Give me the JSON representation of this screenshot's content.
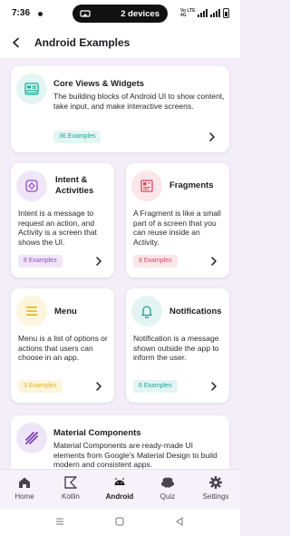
{
  "status_bar": {
    "time": "7:36",
    "cast_label": "2 devices",
    "signal_text_top": "Vo LTE",
    "signal_text_bottom": "4G"
  },
  "app_bar": {
    "title": "Android Examples"
  },
  "cards": [
    {
      "title": "Core Views & Widgets",
      "description": "The building blocks of Android UI to show content, take input, and make interactive screens.",
      "badge": "36 Examples",
      "icon": "layout-icon",
      "accent": "#17a99a",
      "tint": "#e3f6f3"
    },
    {
      "title": "Intent & Activities",
      "description": "Intent is a message to request an action, and Activity is a screen that shows the UI.",
      "badge": "8 Examples",
      "icon": "intent-icon",
      "accent": "#8e4fc4",
      "tint": "#f0e6f8"
    },
    {
      "title": "Fragments",
      "description": "A Fragment is like a small part of a screen that you can reuse inside an Activity.",
      "badge": "8 Examples",
      "icon": "fragments-icon",
      "accent": "#d9475f",
      "tint": "#fbe6e9"
    },
    {
      "title": "Menu",
      "description": "Menu is a list of options or actions that users can choose in an app.",
      "badge": "3 Examples",
      "icon": "menu-icon",
      "accent": "#e2b21c",
      "tint": "#fdf5dc"
    },
    {
      "title": "Notifications",
      "description": "Notification is a message shown outside the app to inform the user.",
      "badge": "6 Examples",
      "icon": "bell-icon",
      "accent": "#1aa39a",
      "tint": "#e2f5f3"
    },
    {
      "title": "Material Components",
      "description": "Material Components are ready-made UI elements from Google's Material Design to build modern and consistent apps.",
      "icon": "material-icon",
      "accent": "#7b3fb1",
      "tint": "#efe5f8"
    }
  ],
  "bottom_nav": [
    {
      "label": "Home",
      "icon": "home-icon",
      "active": false
    },
    {
      "label": "Kotlin",
      "icon": "kotlin-icon",
      "active": false
    },
    {
      "label": "Android",
      "icon": "android-icon",
      "active": true
    },
    {
      "label": "Quiz",
      "icon": "brain-icon",
      "active": false
    },
    {
      "label": "Settings",
      "icon": "gear-icon",
      "active": false
    }
  ],
  "system_nav": [
    "recents-icon",
    "home-button-icon",
    "back-triangle-icon"
  ]
}
